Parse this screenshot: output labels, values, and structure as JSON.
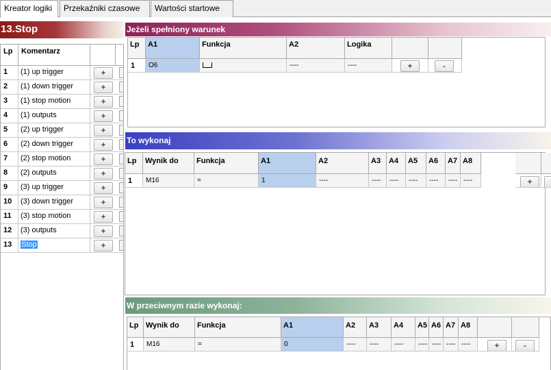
{
  "tabs": [
    {
      "label": "Kreator logiki",
      "active": true
    },
    {
      "label": "Przekaźniki czasowe",
      "active": false
    },
    {
      "label": "Wartości startowe",
      "active": false
    }
  ],
  "left": {
    "title": "13.Stop",
    "headers": {
      "lp": "Lp",
      "comment": "Komentarz"
    },
    "add_label": "+",
    "rows": [
      {
        "lp": "1",
        "comment": "(1) up trigger"
      },
      {
        "lp": "2",
        "comment": "(1) down trigger"
      },
      {
        "lp": "3",
        "comment": "(1) stop motion"
      },
      {
        "lp": "4",
        "comment": "(1) outputs"
      },
      {
        "lp": "5",
        "comment": "(2) up trigger"
      },
      {
        "lp": "6",
        "comment": "(2) down trigger"
      },
      {
        "lp": "7",
        "comment": "(2) stop motion"
      },
      {
        "lp": "8",
        "comment": "(2) outputs"
      },
      {
        "lp": "9",
        "comment": "(3) up trigger"
      },
      {
        "lp": "10",
        "comment": "(3) down trigger"
      },
      {
        "lp": "11",
        "comment": "(3) stop motion"
      },
      {
        "lp": "12",
        "comment": "(3) outputs"
      },
      {
        "lp": "13",
        "comment": "Stop",
        "selected": true
      }
    ]
  },
  "condition": {
    "title": "Jeżeli spełniony warunek",
    "headers": [
      "Lp",
      "A1",
      "Funkcja",
      "A2",
      "Logika"
    ],
    "row": {
      "lp": "1",
      "a1": "O6",
      "funkcja_icon": "falling-edge-icon",
      "a2": "----",
      "logika": "----"
    },
    "add_label": "+",
    "remove_label": "-"
  },
  "then": {
    "title": "To wykonaj",
    "headers": [
      "Lp",
      "Wynik do",
      "Funkcja",
      "A1",
      "A2",
      "A3",
      "A4",
      "A5",
      "A6",
      "A7",
      "A8"
    ],
    "row": [
      "1",
      "M16",
      "=",
      "1",
      "----",
      "----",
      "----",
      "----",
      "----",
      "----",
      "----"
    ],
    "add_label": "+",
    "remove_label": "-"
  },
  "else": {
    "title": "W przeciwnym razie wykonaj:",
    "headers": [
      "Lp",
      "Wynik do",
      "Funkcja",
      "A1",
      "A2",
      "A3",
      "A4",
      "A5",
      "A6",
      "A7",
      "A8"
    ],
    "row": [
      "1",
      "M16",
      "=",
      "0",
      "----",
      "----",
      "----",
      "----",
      "----",
      "----",
      "----"
    ],
    "add_label": "+",
    "remove_label": "-"
  }
}
